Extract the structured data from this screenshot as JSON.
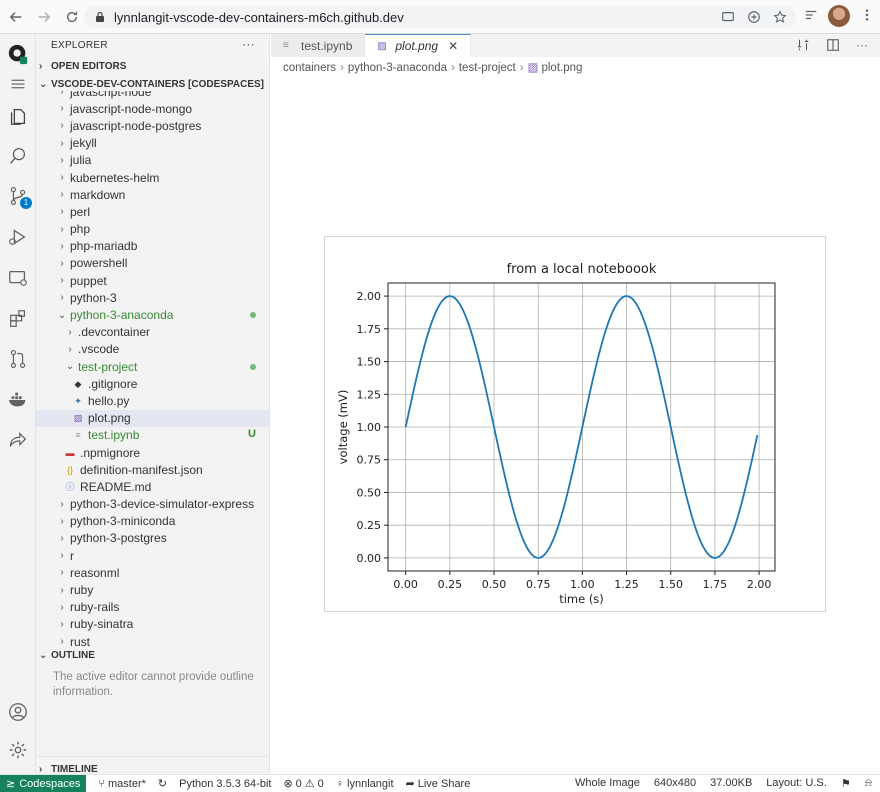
{
  "browser": {
    "url": "lynnlangit-vscode-dev-containers-m6ch.github.dev"
  },
  "sidebar": {
    "title": "EXPLORER",
    "more": "···",
    "open_editors": "OPEN EDITORS",
    "workspace": "VSCODE-DEV-CONTAINERS [CODESPACES]",
    "tree": [
      {
        "label": "javascript-node",
        "indent": 0,
        "type": "folder"
      },
      {
        "label": "javascript-node-mongo",
        "indent": 0,
        "type": "folder"
      },
      {
        "label": "javascript-node-postgres",
        "indent": 0,
        "type": "folder"
      },
      {
        "label": "jekyll",
        "indent": 0,
        "type": "folder"
      },
      {
        "label": "julia",
        "indent": 0,
        "type": "folder"
      },
      {
        "label": "kubernetes-helm",
        "indent": 0,
        "type": "folder"
      },
      {
        "label": "markdown",
        "indent": 0,
        "type": "folder"
      },
      {
        "label": "perl",
        "indent": 0,
        "type": "folder"
      },
      {
        "label": "php",
        "indent": 0,
        "type": "folder"
      },
      {
        "label": "php-mariadb",
        "indent": 0,
        "type": "folder"
      },
      {
        "label": "powershell",
        "indent": 0,
        "type": "folder"
      },
      {
        "label": "puppet",
        "indent": 0,
        "type": "folder"
      },
      {
        "label": "python-3",
        "indent": 0,
        "type": "folder"
      },
      {
        "label": "python-3-anaconda",
        "indent": 0,
        "type": "folder-open",
        "modified": true
      },
      {
        "label": ".devcontainer",
        "indent": 1,
        "type": "folder"
      },
      {
        "label": ".vscode",
        "indent": 1,
        "type": "folder"
      },
      {
        "label": "test-project",
        "indent": 1,
        "type": "folder-open",
        "modified": true
      },
      {
        "label": ".gitignore",
        "indent": 2,
        "type": "gitignore"
      },
      {
        "label": "hello.py",
        "indent": 2,
        "type": "python"
      },
      {
        "label": "plot.png",
        "indent": 2,
        "type": "image",
        "selected": true
      },
      {
        "label": "test.ipynb",
        "indent": 2,
        "type": "notebook",
        "status": "U"
      },
      {
        "label": ".npmignore",
        "indent": 1,
        "type": "npm"
      },
      {
        "label": "definition-manifest.json",
        "indent": 1,
        "type": "json"
      },
      {
        "label": "README.md",
        "indent": 1,
        "type": "info"
      },
      {
        "label": "python-3-device-simulator-express",
        "indent": 0,
        "type": "folder"
      },
      {
        "label": "python-3-miniconda",
        "indent": 0,
        "type": "folder"
      },
      {
        "label": "python-3-postgres",
        "indent": 0,
        "type": "folder"
      },
      {
        "label": "r",
        "indent": 0,
        "type": "folder"
      },
      {
        "label": "reasonml",
        "indent": 0,
        "type": "folder"
      },
      {
        "label": "ruby",
        "indent": 0,
        "type": "folder"
      },
      {
        "label": "ruby-rails",
        "indent": 0,
        "type": "folder"
      },
      {
        "label": "ruby-sinatra",
        "indent": 0,
        "type": "folder"
      },
      {
        "label": "rust",
        "indent": 0,
        "type": "folder"
      }
    ],
    "outline_title": "OUTLINE",
    "outline_message": "The active editor cannot provide outline information.",
    "timeline_title": "TIMELINE"
  },
  "activity": {
    "scm_badge": "1"
  },
  "editor": {
    "tabs": [
      {
        "label": "test.ipynb",
        "active": false
      },
      {
        "label": "plot.png",
        "active": true
      }
    ],
    "breadcrumb": [
      "containers",
      "python-3-anaconda",
      "test-project",
      "plot.png"
    ]
  },
  "chart_data": {
    "type": "line",
    "title": "from a local noteboook",
    "xlabel": "time (s)",
    "ylabel": "voltage (mV)",
    "xlim": [
      -0.1,
      2.09
    ],
    "ylim": [
      -0.1,
      2.1
    ],
    "xticks": [
      "0.00",
      "0.25",
      "0.50",
      "0.75",
      "1.00",
      "1.25",
      "1.50",
      "1.75",
      "2.00"
    ],
    "yticks": [
      "0.00",
      "0.25",
      "0.50",
      "0.75",
      "1.00",
      "1.25",
      "1.50",
      "1.75",
      "2.00"
    ],
    "grid": true,
    "series": [
      {
        "x": [
          0.0,
          0.25,
          0.5,
          0.75,
          1.0,
          1.25,
          1.5,
          1.75,
          1.99
        ],
        "y": [
          1.0,
          2.0,
          1.0,
          0.0,
          1.0,
          2.0,
          1.0,
          0.0,
          0.94
        ],
        "color": "#1f77b4"
      }
    ]
  },
  "status": {
    "remote": "Codespaces",
    "branch": "master*",
    "python": "Python 3.5.3 64-bit",
    "problems": "0",
    "warnings": "0",
    "user": "lynnlangit",
    "liveshare": "Live Share",
    "view": "Whole Image",
    "dims": "640x480",
    "size": "37.00KB",
    "layout": "Layout: U.S."
  }
}
